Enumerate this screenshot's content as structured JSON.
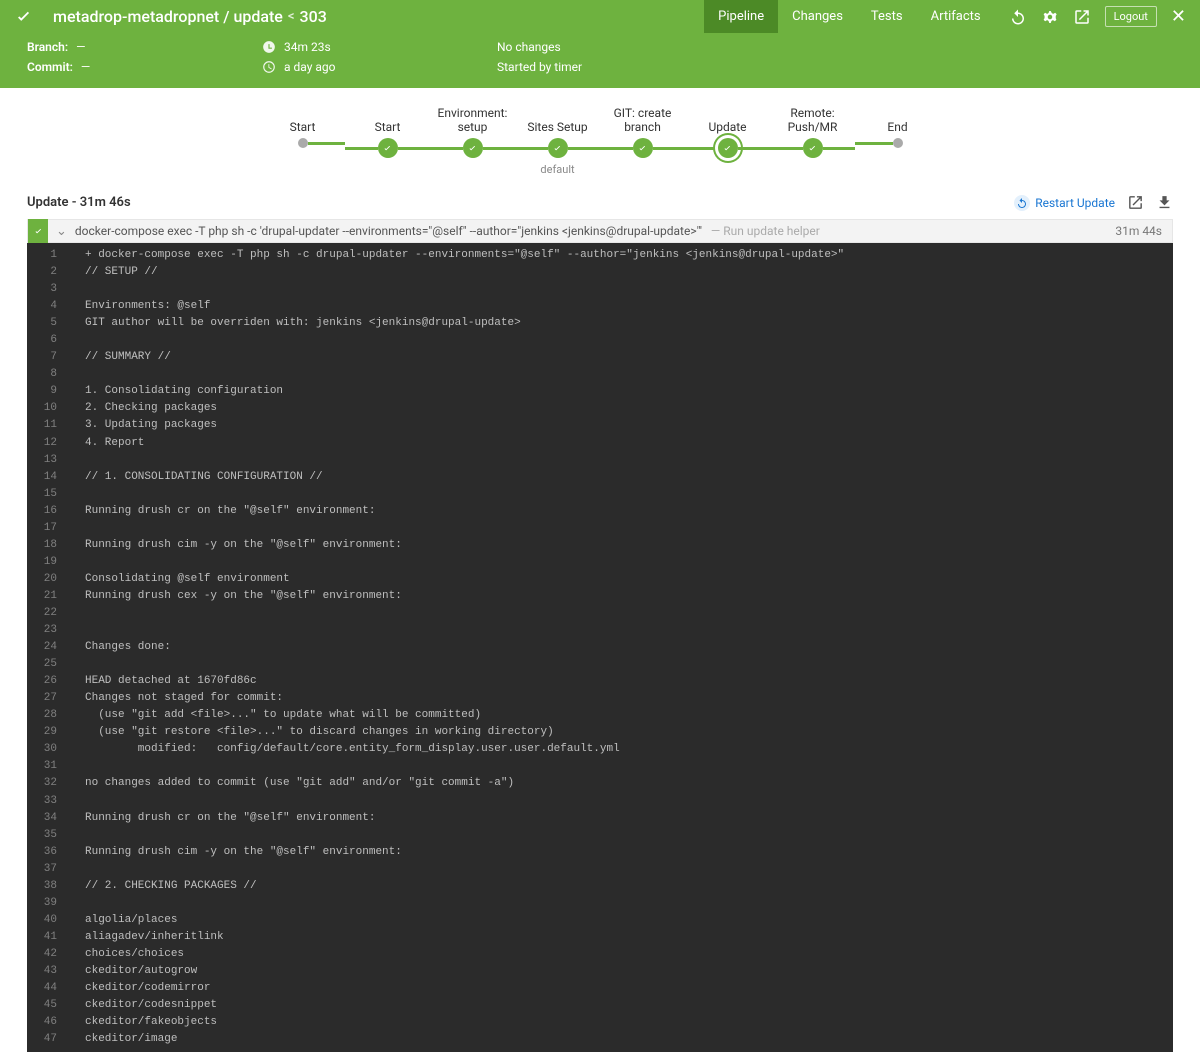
{
  "header": {
    "project": "metadrop-metadropnet / update",
    "build_number": "303",
    "tabs": [
      {
        "label": "Pipeline",
        "active": true
      },
      {
        "label": "Changes",
        "active": false
      },
      {
        "label": "Tests",
        "active": false
      },
      {
        "label": "Artifacts",
        "active": false
      }
    ],
    "logout": "Logout"
  },
  "meta": {
    "branch_label": "Branch:",
    "branch_value": "—",
    "commit_label": "Commit:",
    "commit_value": "—",
    "duration": "34m 23s",
    "when": "a day ago",
    "changes": "No changes",
    "started_by": "Started by timer"
  },
  "stages": [
    {
      "label": "Start",
      "type": "small"
    },
    {
      "label": "Start",
      "type": "check"
    },
    {
      "label": "Environment: setup",
      "type": "check"
    },
    {
      "label": "Sites Setup",
      "type": "check",
      "sublabel": "default"
    },
    {
      "label": "GIT: create branch",
      "type": "check"
    },
    {
      "label": "Update",
      "type": "check",
      "active": true
    },
    {
      "label": "Remote: Push/MR",
      "type": "check"
    },
    {
      "label": "End",
      "type": "small"
    }
  ],
  "step": {
    "title": "Update - 31m 46s",
    "restart": "Restart Update",
    "command": "docker-compose exec -T php sh -c 'drupal-updater --environments=\"@self\" --author=\"jenkins <jenkins@drupal-update>\"'",
    "hint": "— Run update helper",
    "time": "31m 44s"
  },
  "console": [
    "+ docker-compose exec -T php sh -c drupal-updater --environments=\"@self\" --author=\"jenkins <jenkins@drupal-update>\"",
    "// SETUP //",
    "",
    "Environments: @self",
    "GIT author will be overriden with: jenkins <jenkins@drupal-update>",
    "",
    "// SUMMARY //",
    "",
    "1. Consolidating configuration",
    "2. Checking packages",
    "3. Updating packages",
    "4. Report",
    "",
    "// 1. CONSOLIDATING CONFIGURATION //",
    "",
    "Running drush cr on the \"@self\" environment:",
    "",
    "Running drush cim -y on the \"@self\" environment:",
    "",
    "Consolidating @self environment",
    "Running drush cex -y on the \"@self\" environment:",
    "",
    "",
    "Changes done:",
    "",
    "HEAD detached at 1670fd86c",
    "Changes not staged for commit:",
    "  (use \"git add <file>...\" to update what will be committed)",
    "  (use \"git restore <file>...\" to discard changes in working directory)",
    "        modified:   config/default/core.entity_form_display.user.user.default.yml",
    "",
    "no changes added to commit (use \"git add\" and/or \"git commit -a\")",
    "",
    "Running drush cr on the \"@self\" environment:",
    "",
    "Running drush cim -y on the \"@self\" environment:",
    "",
    "// 2. CHECKING PACKAGES //",
    "",
    "algolia/places",
    "aliagadev/inheritlink",
    "choices/choices",
    "ckeditor/autogrow",
    "ckeditor/codemirror",
    "ckeditor/codesnippet",
    "ckeditor/fakeobjects",
    "ckeditor/image"
  ]
}
